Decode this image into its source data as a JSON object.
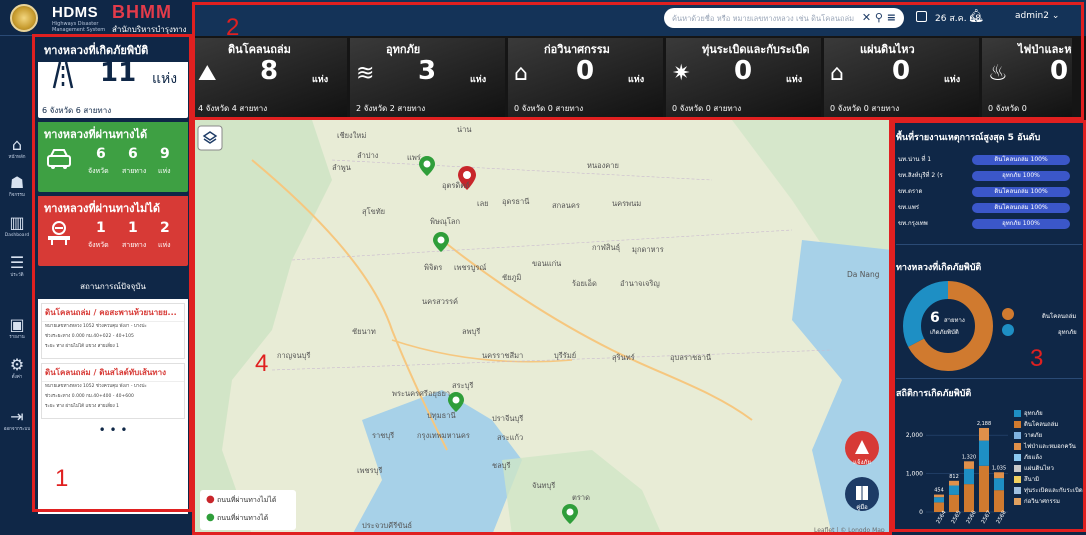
{
  "header": {
    "logo_text": "HDMS",
    "logo_subtitle": "Highways Disaster Management System",
    "brand_text": "BHMM",
    "brand_subtitle": "สำนักบริหารบำรุงทาง",
    "search_placeholder": "ค้นหาด้วยชื่อ หรือ หมายเลขทางหลวง เช่น ดินโคลนถล่ม",
    "date": "26 ส.ค. 68",
    "user": "admin2"
  },
  "nav": [
    {
      "label": "หน้าหลัก",
      "icon": "home-icon"
    },
    {
      "label": "กิจกรรม",
      "icon": "people-icon"
    },
    {
      "label": "Dashboard",
      "icon": "chart-icon"
    },
    {
      "label": "ประวัติ",
      "icon": "database-icon"
    },
    {
      "label": "รายงาน",
      "icon": "image-icon"
    },
    {
      "label": "ตั้งค่า",
      "icon": "gear-icon"
    },
    {
      "label": "ออกจากระบบ",
      "icon": "logout-icon"
    }
  ],
  "summary": {
    "affected": {
      "title": "ทางหลวงที่เกิดภัยพิบัติ",
      "count": "11",
      "unit": "แห่ง",
      "footer": "6   จังหวัด  6    สายทาง"
    },
    "passable": {
      "title": "ทางหลวงที่ผ่านทางได้",
      "v1": "6",
      "v2": "6",
      "v3": "9",
      "l1": "จังหวัด",
      "l2": "สายทาง",
      "l3": "แห่ง"
    },
    "impassable": {
      "title": "ทางหลวงที่ผ่านทางไม่ได้",
      "v1": "1",
      "v2": "1",
      "v3": "2",
      "l1": "จังหวัด",
      "l2": "สายทาง",
      "l3": "แห่ง"
    }
  },
  "status": {
    "title": "สถานการณ์ปัจจุบัน",
    "items": [
      {
        "title": "ดินโคลนถล่ม / คอสะพานห้วยนายย...",
        "row1": "หมายเลขทางหลวง  1052  ช่วงควบคุม  พังงา - บางปะ",
        "row2": "ช่วงระยะทาง  0.000  กม.40+022 - 40+105",
        "row3": "ระยะ ทาง  ผ่านไม่ได้  แขวง  สายเลี่ยง 1",
        "state": "ผ่านไม่ได้"
      },
      {
        "title": "ดินโคลนถล่ม / ดินสไลด์ทับเส้นทาง",
        "row1": "หมายเลขทางหลวง  1052  ช่วงควบคุม  พังงา - บางปะ",
        "row2": "ช่วงระยะทาง  0.000  กม.40+400 - 40+600",
        "row3": "ระยะ ทาง  ผ่านไม่ได้  แขวง  สายเลี่ยง 1",
        "state": "ผ่านไม่ได้"
      }
    ],
    "more": "• • •"
  },
  "tiles": [
    {
      "title": "ดินโคลนถล่ม",
      "count": "8",
      "unit": "แห่ง",
      "footer": "4   จังหวัด  4     สายทาง",
      "icon": "landslide-icon",
      "ico": "⛰"
    },
    {
      "title": "อุทกภัย",
      "count": "3",
      "unit": "แห่ง",
      "footer": "2   จังหวัด  2     สายทาง",
      "icon": "flood-icon",
      "ico": "≋"
    },
    {
      "title": "ก่อวินาศกรรม",
      "count": "0",
      "unit": "แห่ง",
      "footer": "0   จังหวัด  0     สายทาง",
      "icon": "sabotage-icon",
      "ico": "⌂"
    },
    {
      "title": "ทุ่นระเบิดและกับระเบิด",
      "count": "0",
      "unit": "แห่ง",
      "footer": "0   จังหวัด  0     สายทาง",
      "icon": "explosion-icon",
      "ico": "✷"
    },
    {
      "title": "แผ่นดินไหว",
      "count": "0",
      "unit": "แห่ง",
      "footer": "0   จังหวัด  0     สายทาง",
      "icon": "earthquake-icon",
      "ico": "⌂"
    },
    {
      "title": "ไฟป่าและหมอ",
      "count": "0",
      "unit": "แห่ง",
      "footer": "0   จังหวัด  0",
      "icon": "fire-icon",
      "ico": "♨"
    }
  ],
  "map": {
    "labels": [
      "เชียงใหม่",
      "น่าน",
      "ลำปาง",
      "แพร่",
      "ลำพูน",
      "อุตรดิตถ์",
      "หนองคาย",
      "สุโขทัย",
      "พิษณุโลก",
      "อุดรธานี",
      "สกลนคร",
      "นครพนม",
      "เลย",
      "กาฬสินธุ์",
      "มุกดาหาร",
      "พิจิตร",
      "เพชรบูรณ์",
      "ขอนแก่น",
      "ร้อยเอ็ด",
      "อำนาจเจริญ",
      "ชัยภูมิ",
      "นครสวรรค์",
      "ชัยนาท",
      "ลพบุรี",
      "กาญจนบุรี",
      "นครราชสีมา",
      "บุรีรัมย์",
      "สุรินทร์",
      "อุบลราชธานี",
      "สระบุรี",
      "พระนครศรีอยุธยา",
      "ปทุมธานี",
      "ปราจีนบุรี",
      "ราชบุรี",
      "กรุงเทพมหานคร",
      "สระแก้ว",
      "ชลบุรี",
      "เพชรบุรี",
      "จันทบุรี",
      "ตราด",
      "ประจวบคีรีขันธ์",
      "Da Nang"
    ],
    "legend_red": "ถนนที่ผ่านทางไม่ได้",
    "legend_green": "ถนนที่ผ่านทางได้",
    "report_button": "แจ้งภัย",
    "manual_button": "คู่มือ",
    "attribution": "Leaflet | © Longdo Map"
  },
  "top5": {
    "title": "พื้นที่รายงานเหตุการณ์สูงสุด 5 อันดับ",
    "rows": [
      {
        "area": "นท.น่าน ที่ 1",
        "label": "ดินโคลนถล่ม 100%"
      },
      {
        "area": "ขท.สิงห์บุรีที่ 2 (ร",
        "label": "อุทกภัย 100%"
      },
      {
        "area": "ขท.ตราด",
        "label": "ดินโคลนถล่ม 100%"
      },
      {
        "area": "ขท.แพร่",
        "label": "ดินโคลนถล่ม 100%"
      },
      {
        "area": "ขท.กรุงเทพ",
        "label": "อุทกภัย 100%"
      }
    ]
  },
  "donut": {
    "title": "ทางหลวงที่เกิดภัยพิบัติ",
    "center_value": "6",
    "center_unit": "สายทาง",
    "center_sub": "เกิดภัยพิบัติ",
    "legend": [
      {
        "name": "ดินโคลนถล่ม",
        "color": "#d07a2f"
      },
      {
        "name": "อุทกภัย",
        "color": "#1e8fc4"
      }
    ]
  },
  "stats": {
    "title": "สถิติการเกิดภัยพิบัติ",
    "legend": [
      "อุทกภัย",
      "ดินโคลนถล่ม",
      "วาตภัย",
      "ไฟป่าและหมอกควัน",
      "ภัยแล้ง",
      "แผ่นดินไหว",
      "สึนามิ",
      "ทุ่นระเบิดและกับระเบิด",
      "ก่อวินาศกรรม"
    ],
    "colors": [
      "#1e8fc4",
      "#d07a2f",
      "#7fb2e0",
      "#e0904a",
      "#8bc8f0",
      "#c8c8c8",
      "#f0d060",
      "#a0c0e0",
      "#e0a060"
    ]
  },
  "chart_data": {
    "type": "bar",
    "categories": [
      "2564",
      "2565",
      "2566",
      "2567",
      "2568"
    ],
    "values": [
      454,
      812,
      1320,
      2188,
      1035
    ],
    "yticks": [
      "0",
      "1,000",
      "2,000"
    ],
    "ylim": [
      0,
      2500
    ]
  },
  "annotations": [
    "1",
    "2",
    "3",
    "4"
  ]
}
